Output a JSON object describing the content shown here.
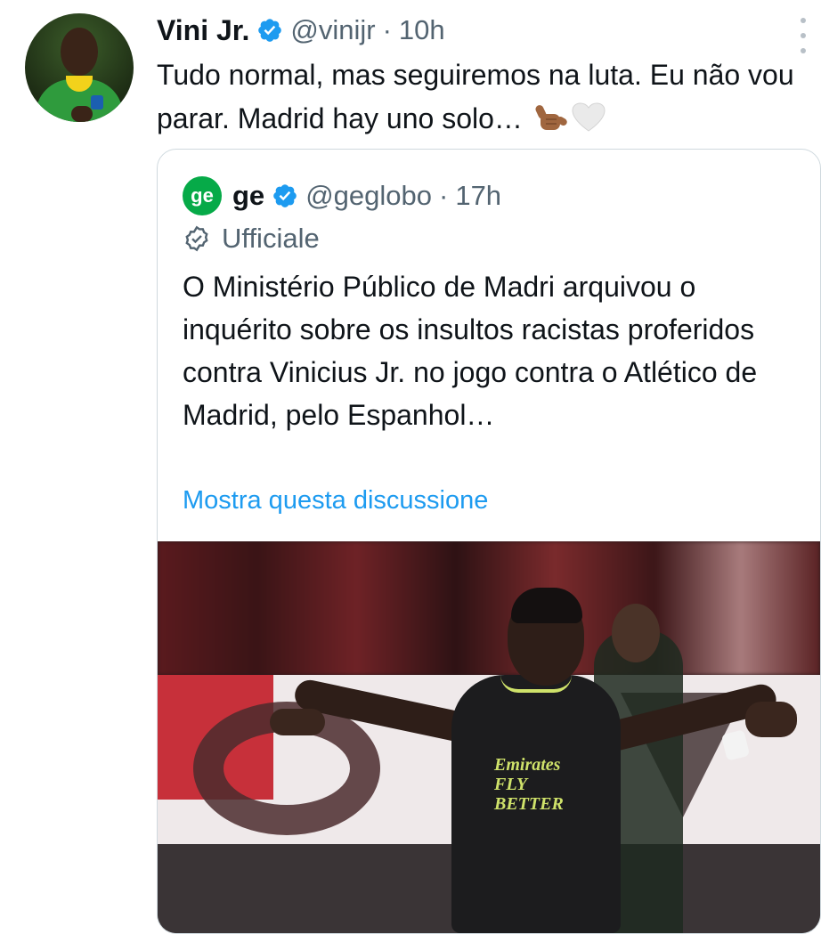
{
  "tweet": {
    "author_name": "Vini Jr.",
    "handle": "@vinijr",
    "separator": "·",
    "time": "10h",
    "text": "Tudo normal, mas seguiremos na luta. Eu não vou parar. Madrid hay uno solo…",
    "emojis": [
      "call-me-hand-medium-dark-skin",
      "white-heart"
    ]
  },
  "quoted_tweet": {
    "logo_text": "ge",
    "author_name": "ge",
    "handle": "@geglobo",
    "separator": "·",
    "time": "17h",
    "label": "Ufficiale",
    "text": "O Ministério Público de Madri arquivou o inquérito sobre os insultos racistas proferidos contra Vinicius Jr. no jogo contra o Atlético de Madrid, pelo Espanhol…",
    "show_thread_link": "Mostra questa discussione",
    "photo": {
      "sponsor_text": "Emirates FLY BETTER"
    }
  },
  "colors": {
    "verified": "#1d9bf0",
    "link": "#1d9bf0",
    "ge_brand": "#06aa48",
    "secondary_text": "#536471"
  },
  "icons": [
    "verified-badge-icon",
    "more-options-icon",
    "official-badge-icon"
  ]
}
